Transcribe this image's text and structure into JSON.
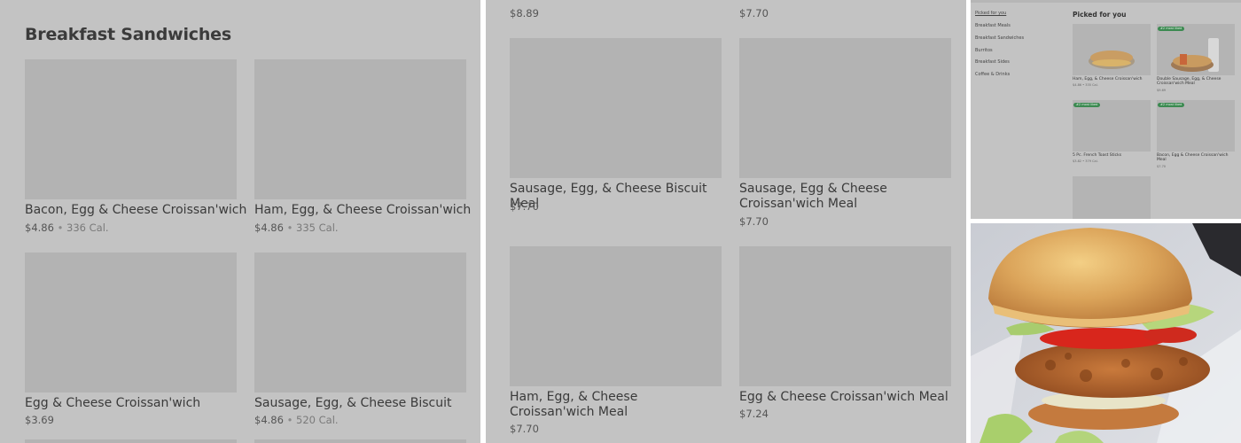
{
  "left_panel": {
    "section_title": "Breakfast Sandwiches",
    "items": [
      {
        "name": "Bacon, Egg & Cheese Croissan'wich",
        "price": "$4.86",
        "calories": "336 Cal."
      },
      {
        "name": "Ham, Egg, & Cheese Croissan'wich",
        "price": "$4.86",
        "calories": "335 Cal."
      },
      {
        "name": "Egg & Cheese Croissan'wich",
        "price": "$3.69",
        "calories": ""
      },
      {
        "name": "Sausage, Egg, & Cheese Biscuit",
        "price": "$4.86",
        "calories": "520 Cal."
      }
    ]
  },
  "middle_panel": {
    "top_prices": [
      "$8.89",
      "$7.70"
    ],
    "items": [
      {
        "name": "Sausage, Egg, & Cheese Biscuit Meal",
        "price": "$7.70"
      },
      {
        "name": "Sausage, Egg & Cheese Croissan'wich Meal",
        "price": "$7.70"
      },
      {
        "name": "Ham, Egg, & Cheese Croissan'wich Meal",
        "price": "$7.70"
      },
      {
        "name": "Egg & Cheese Croissan'wich Meal",
        "price": "$7.24"
      }
    ]
  },
  "mini_panel": {
    "nav": [
      "Picked for you",
      "Breakfast Meals",
      "Breakfast Sandwiches",
      "Burritos",
      "Breakfast Sides",
      "Coffee & Drinks"
    ],
    "title": "Picked for you",
    "badge": "#2 most liked",
    "cards": [
      {
        "name": "Ham, Egg, & Cheese Croissan'wich",
        "meta": "$4.86 • 335 Cal."
      },
      {
        "name": "Double Sausage, Egg, & Cheese Croissan'wich Meal",
        "meta": "$9.69"
      },
      {
        "name": "5 Pc. French Toast Sticks",
        "meta": "$3.82 • 379 Cal."
      },
      {
        "name": "Bacon, Egg & Cheese Croissan'wich Meal",
        "meta": "$7.70"
      }
    ]
  },
  "photo": {
    "subject": "crispy chicken sandwich with lettuce and tomato on a sesame-free bun"
  }
}
